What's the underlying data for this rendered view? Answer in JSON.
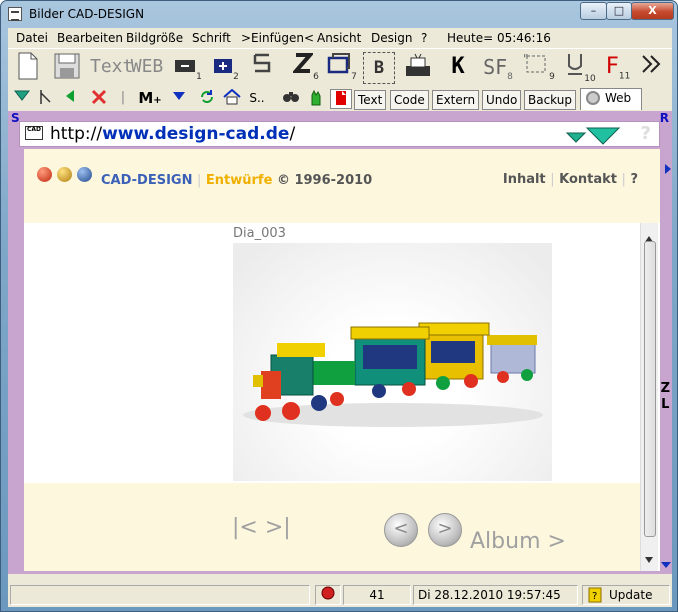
{
  "window": {
    "title": "Bilder CAD-DESIGN",
    "min": "–",
    "max": "□",
    "close": "X"
  },
  "menu": [
    "Datei",
    "Bearbeiten",
    "Bildgröße",
    "Schrift",
    ">Einfügen<",
    "Ansicht",
    "Design",
    "?",
    "Heute= 05:46:16"
  ],
  "toolbar1": {
    "text_label": "Text",
    "web_label": "WEB",
    "b_label": "B",
    "k_label": "K",
    "sf_label": "SF",
    "f_label": "F",
    "sub1": "1",
    "sub2": "2",
    "sub6": "6",
    "sub7": "7",
    "sub8": "8",
    "sub9": "9",
    "sub10": "10",
    "sub11": "11"
  },
  "toolbar2": {
    "m_label": "M",
    "s_label": "S..",
    "tabs": [
      "Text",
      "Code",
      "Extern",
      "Undo",
      "Backup",
      "Web"
    ]
  },
  "side_labels": {
    "s": "S",
    "r": "R",
    "z": "Z",
    "l": "L"
  },
  "address": {
    "prefix": "http://",
    "domain": "www.design-cad.de",
    "suffix": "/"
  },
  "site": {
    "brand": "CAD-DESIGN",
    "sep": "|",
    "entwuerfe": "Entwürfe",
    "copyright": "© 1996-2010",
    "nav_inhalt": "Inhalt",
    "nav_kontakt": "Kontakt",
    "nav_help": "?"
  },
  "gallery": {
    "caption": "Dia_003",
    "pager": "|< >|",
    "prev": "<",
    "next": ">",
    "album": "Album >"
  },
  "status": {
    "count": "41",
    "datetime": "Di 28.12.2010 19:57:45",
    "update": "Update"
  },
  "colors": {
    "accent": "#0030b8",
    "frame": "#c8a5cf",
    "header_bg": "#fdf7de"
  }
}
